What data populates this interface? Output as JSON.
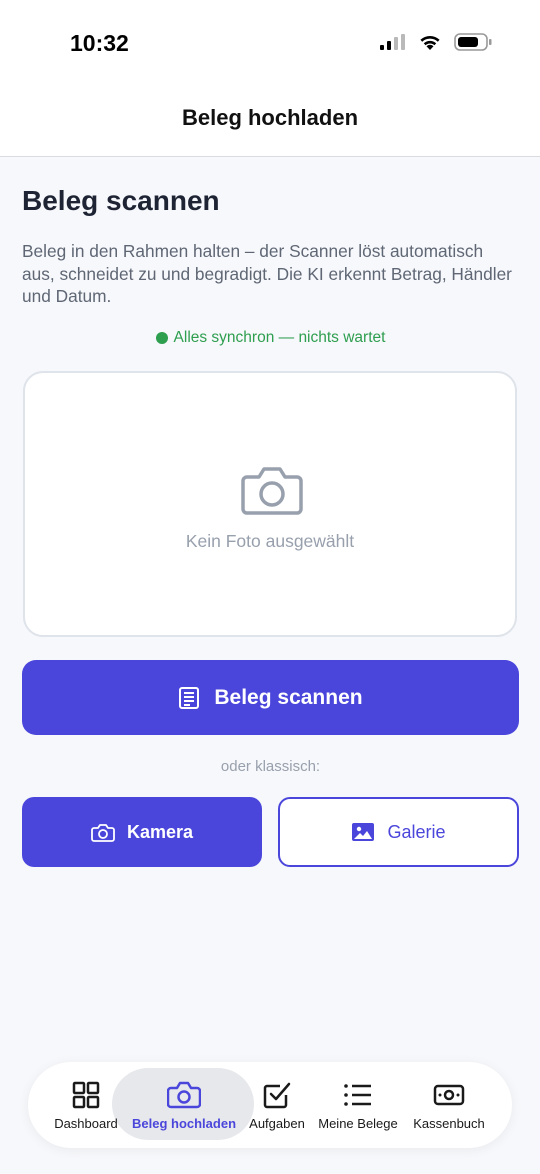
{
  "status_bar": {
    "time": "10:32"
  },
  "header": {
    "title": "Beleg hochladen"
  },
  "main": {
    "title": "Beleg scannen",
    "description": "Beleg in den Rahmen halten – der Scanner löst automatisch aus, schneidet zu und begradigt. Die KI erkennt Betrag, Händler und Datum.",
    "sync_status": "Alles synchron — nichts wartet",
    "photo_placeholder": "Kein Foto ausgewählt",
    "scan_button_label": "Beleg scannen",
    "or_text": "oder klassisch:",
    "camera_button_label": "Kamera",
    "gallery_button_label": "Galerie"
  },
  "tabbar": {
    "items": [
      {
        "label": "Dashboard",
        "icon": "grid-icon"
      },
      {
        "label": "Beleg hochladen",
        "icon": "camera-icon",
        "active": true
      },
      {
        "label": "Aufgaben",
        "icon": "checkbox-icon"
      },
      {
        "label": "Meine Belege",
        "icon": "list-icon"
      },
      {
        "label": "Kassenbuch",
        "icon": "cash-icon"
      }
    ]
  },
  "colors": {
    "accent": "#4b46db",
    "sync_green": "#2e9e4f",
    "background": "#f7f8fb"
  }
}
